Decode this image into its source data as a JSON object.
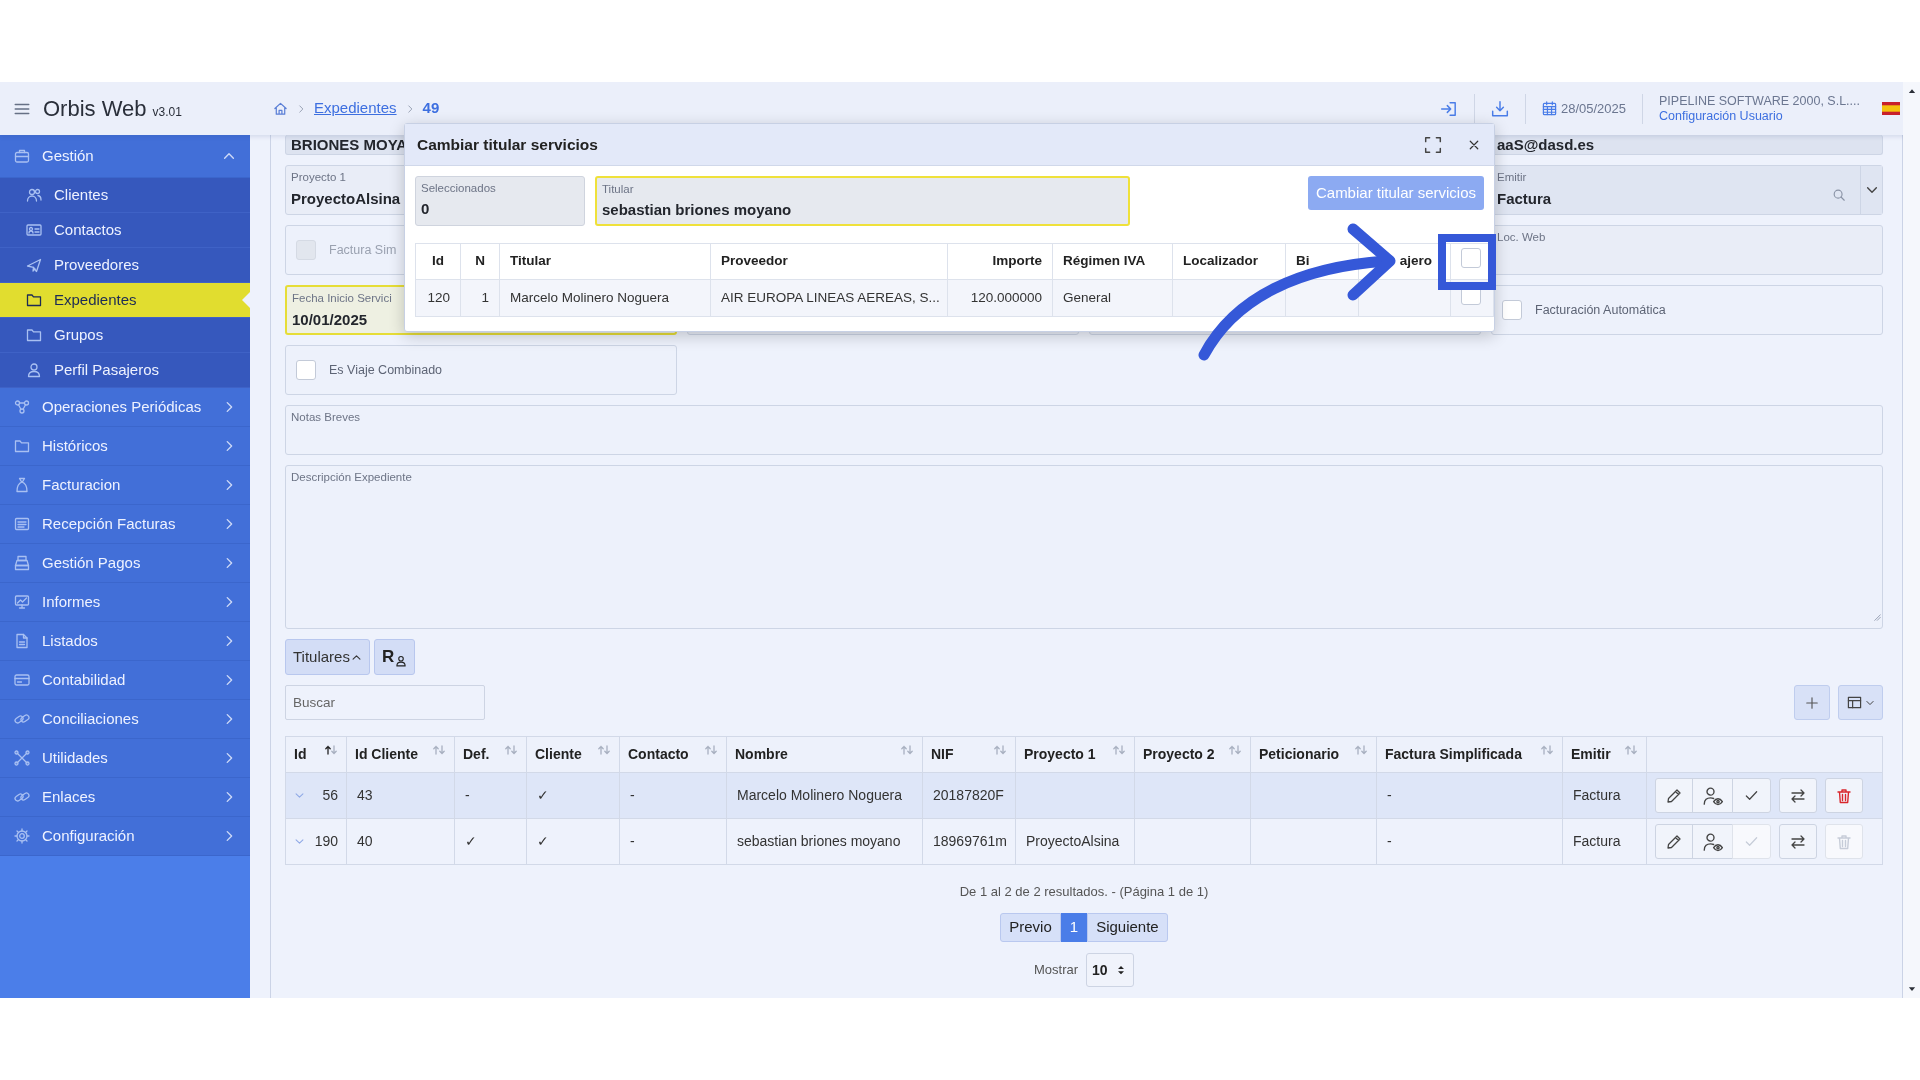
{
  "header": {
    "app_name": "Orbis Web",
    "version": "v3.01",
    "breadcrumb": [
      {
        "label": "Expedientes",
        "kind": "link"
      },
      {
        "label": "49",
        "kind": "current"
      }
    ],
    "date": "28/05/2025",
    "company": "PIPELINE SOFTWARE 2000, S.L....",
    "user_link": "Configuración Usuario"
  },
  "sidebar": {
    "items": [
      {
        "label": "Gestión",
        "expanded": true,
        "selected": false,
        "children": [
          {
            "label": "Clientes",
            "selected": false
          },
          {
            "label": "Contactos",
            "selected": false
          },
          {
            "label": "Proveedores",
            "selected": false
          },
          {
            "label": "Expedientes",
            "selected": true
          },
          {
            "label": "Grupos",
            "selected": false
          },
          {
            "label": "Perfil Pasajeros",
            "selected": false
          }
        ]
      },
      {
        "label": "Operaciones Periódicas",
        "expanded": false,
        "selected": false
      },
      {
        "label": "Históricos",
        "expanded": false,
        "selected": false
      },
      {
        "label": "Facturacion",
        "expanded": false,
        "selected": false
      },
      {
        "label": "Recepción Facturas",
        "expanded": false,
        "selected": false
      },
      {
        "label": "Gestión Pagos",
        "expanded": false,
        "selected": false
      },
      {
        "label": "Informes",
        "expanded": false,
        "selected": false
      },
      {
        "label": "Listados",
        "expanded": false,
        "selected": false
      },
      {
        "label": "Contabilidad",
        "expanded": false,
        "selected": false
      },
      {
        "label": "Conciliaciones",
        "expanded": false,
        "selected": false
      },
      {
        "label": "Utilidades",
        "expanded": false,
        "selected": false
      },
      {
        "label": "Enlaces",
        "expanded": false,
        "selected": false
      },
      {
        "label": "Configuración",
        "expanded": false,
        "selected": false
      }
    ]
  },
  "form": {
    "fields": [
      {
        "kind": "text",
        "value": "BRIONES MOYA"
      },
      {
        "kind": "text",
        "value": "aaS@dasd.es"
      },
      {
        "kind": "text",
        "label": "Proyecto 1",
        "value": "ProyectoAlsina"
      },
      {
        "kind": "select",
        "label": "Emitir",
        "value": "Factura"
      },
      {
        "kind": "checkbox",
        "label": "Factura Sim",
        "checked": false,
        "disabled": true
      },
      {
        "kind": "text",
        "label": "Loc. Web"
      },
      {
        "kind": "text",
        "label": "Fecha Inicio Servici",
        "value": "10/01/2025",
        "highlighted": true
      },
      {
        "kind": "text"
      },
      {
        "kind": "text"
      },
      {
        "kind": "checkbox",
        "label": "Facturación Automática",
        "checked": false,
        "disabled": false
      },
      {
        "kind": "checkbox",
        "label": "Es Viaje Combinado",
        "checked": false,
        "disabled": false
      },
      {
        "kind": "textarea",
        "label": "Notas Breves"
      },
      {
        "kind": "textarea",
        "label": "Descripción Expediente",
        "resizable": true
      }
    ]
  },
  "titulares": {
    "label": "Titulares",
    "expanded": true,
    "side_button_text": "R"
  },
  "search": {
    "placeholder": "Buscar"
  },
  "table": {
    "columns": [
      {
        "label": "Id",
        "sorted": true
      },
      {
        "label": "Id Cliente",
        "sorted": false
      },
      {
        "label": "Def.",
        "sorted": false
      },
      {
        "label": "Cliente",
        "sorted": false
      },
      {
        "label": "Contacto",
        "sorted": false
      },
      {
        "label": "Nombre",
        "sorted": false
      },
      {
        "label": "NIF",
        "sorted": false
      },
      {
        "label": "Proyecto 1",
        "sorted": false
      },
      {
        "label": "Proyecto 2",
        "sorted": false
      },
      {
        "label": "Peticionario",
        "sorted": false
      },
      {
        "label": "Factura Simplificada",
        "sorted": false
      },
      {
        "label": "Emitir",
        "sorted": false
      }
    ],
    "rows": [
      {
        "id": "56",
        "id_cliente": "43",
        "def": "-",
        "cliente": "✓",
        "contacto": "-",
        "nombre": "Marcelo Molinero Noguera",
        "nif": "20187820F",
        "factura_simplificada": "-",
        "emitir": "Factura",
        "highlighted": true,
        "validate_disabled": false,
        "delete_disabled": false
      },
      {
        "id": "190",
        "id_cliente": "40",
        "def": "✓",
        "cliente": "✓",
        "contacto": "-",
        "nombre": "sebastian briones moyano",
        "nif": "18969761m",
        "proyecto_1": "ProyectoAlsina",
        "factura_simplificada": "-",
        "emitir": "Factura",
        "highlighted": false,
        "validate_disabled": true,
        "delete_disabled": true
      }
    ]
  },
  "pagination": {
    "summary": "De 1 al 2 de 2 resultados. - (Página 1 de 1)",
    "prev": "Previo",
    "pages": [
      {
        "label": "1",
        "selected": true
      }
    ],
    "next": "Siguiente",
    "show_label": "Mostrar",
    "page_size": "10"
  },
  "modal": {
    "title": "Cambiar titular servicios",
    "fields": [
      {
        "label": "Seleccionados",
        "value": "0",
        "highlighted": false
      },
      {
        "label": "Titular",
        "value": "sebastian briones moyano",
        "highlighted": true
      }
    ],
    "action": {
      "label": "Cambiar titular servicios",
      "disabled": true
    },
    "table": {
      "columns": [
        "Id",
        "N",
        "Titular",
        "Proveedor",
        "Importe",
        "Régimen IVA",
        "Localizador",
        "Bi",
        "ajero"
      ],
      "header_checked": false,
      "rows": [
        {
          "id": "120",
          "n": "1",
          "titular": "Marcelo Molinero Noguera",
          "proveedor": "AIR EUROPA LINEAS AEREAS, S...",
          "importe": "120.000000",
          "regimen_iva": "General",
          "checked": false
        }
      ]
    }
  }
}
